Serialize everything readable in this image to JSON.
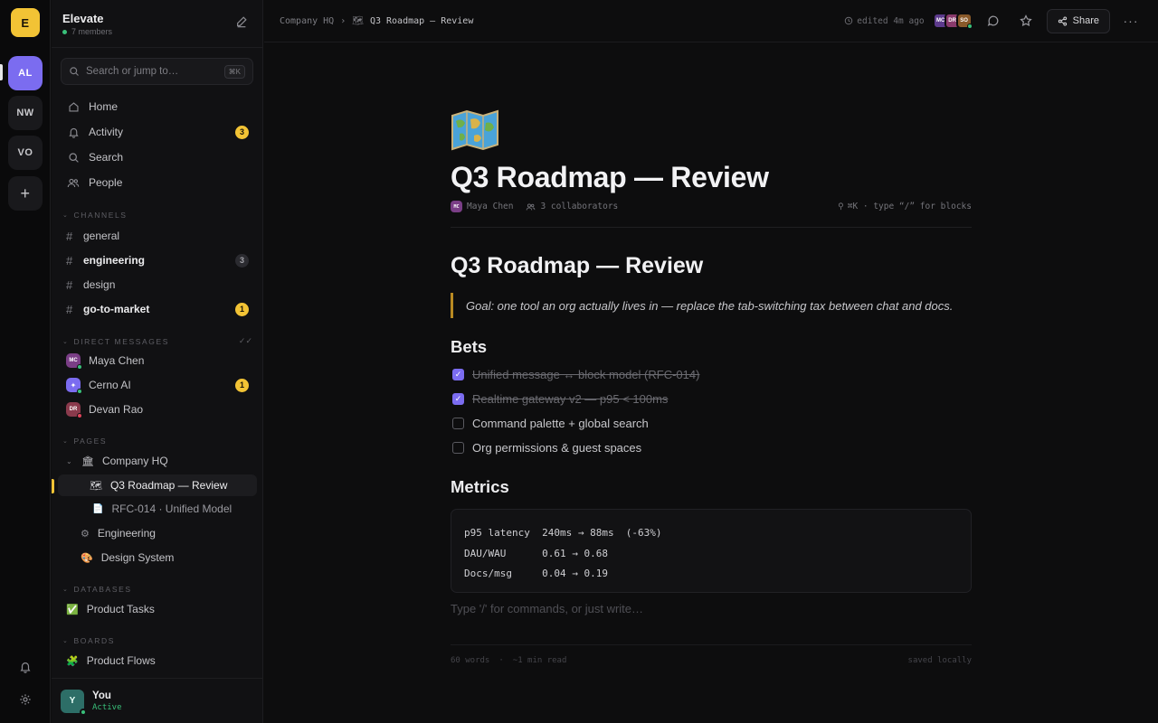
{
  "rail": {
    "logo": "E",
    "workspaces": [
      "AL",
      "NW",
      "VO"
    ],
    "add_icon": "plus-icon",
    "bottom_icons": [
      "bell-icon",
      "gear-icon"
    ]
  },
  "sidebar": {
    "workspace_name": "Elevate",
    "members": "7 members",
    "search_placeholder": "Search or jump to…",
    "search_shortcut": "⌘K",
    "nav": [
      {
        "label": "Home",
        "icon": "home-icon",
        "badge": ""
      },
      {
        "label": "Activity",
        "icon": "bell-icon",
        "badge": "3"
      },
      {
        "label": "Search",
        "icon": "search-icon",
        "badge": ""
      },
      {
        "label": "People",
        "icon": "people-icon",
        "badge": ""
      }
    ],
    "channels_label": "CHANNELS",
    "channels": [
      {
        "name": "general",
        "badge": ""
      },
      {
        "name": "engineering",
        "badge": "3"
      },
      {
        "name": "design",
        "badge": ""
      },
      {
        "name": "go-to-market",
        "badge": "1"
      }
    ],
    "dms_label": "DIRECT MESSAGES",
    "dms": [
      {
        "initials": "MC",
        "name": "Maya Chen",
        "badge": "",
        "color": "#7a3e86",
        "status": "#39c07a"
      },
      {
        "initials": "✦",
        "name": "Cerno AI",
        "badge": "1",
        "color": "#7b6cf0",
        "status": "#39c07a"
      },
      {
        "initials": "DR",
        "name": "Devan Rao",
        "badge": "",
        "color": "#8a3a4c",
        "status": "#e0445a"
      }
    ],
    "pages_label": "PAGES",
    "pages": [
      {
        "label": "Company HQ",
        "icon": "🏛"
      },
      {
        "label": "Q3 Roadmap — Review",
        "icon": "🗺"
      },
      {
        "label": "RFC-014 · Unified Model",
        "icon": "📄"
      },
      {
        "label": "Engineering",
        "icon": "⚙"
      },
      {
        "label": "Design System",
        "icon": "🎨"
      }
    ],
    "databases_label": "DATABASES",
    "databases": [
      {
        "label": "Product Tasks",
        "icon": "✅"
      }
    ],
    "boards_label": "BOARDS",
    "boards": [
      {
        "label": "Product Flows",
        "icon": "🧩"
      }
    ],
    "user": {
      "initial": "Y",
      "name": "You",
      "status": "Active"
    }
  },
  "topbar": {
    "breadcrumb_root": "Company HQ",
    "breadcrumb_page": "Q3 Roadmap — Review",
    "breadcrumb_icon": "🗺",
    "edited": "edited 4m ago",
    "collaborators": [
      {
        "initials": "MC",
        "color": "#5c3a8c"
      },
      {
        "initials": "DR",
        "color": "#8a3a6c"
      },
      {
        "initials": "SO",
        "color": "#8a5a2a"
      }
    ],
    "share_label": "Share"
  },
  "document": {
    "emoji": "map-emoji",
    "title": "Q3 Roadmap — Review",
    "author_initials": "MC",
    "author": "Maya Chen",
    "collaborators_count": "3 collaborators",
    "hint": "⌘K · type “/” for blocks",
    "heading": "Q3 Roadmap — Review",
    "quote": "Goal: one tool an org actually lives in — replace the tab-switching tax between chat and docs.",
    "bets_heading": "Bets",
    "bets": [
      {
        "label": "Unified message ↔ block model (RFC-014)",
        "done": true
      },
      {
        "label": "Realtime gateway v2 — p95 < 100ms",
        "done": true
      },
      {
        "label": "Command palette + global search",
        "done": false
      },
      {
        "label": "Org permissions & guest spaces",
        "done": false
      }
    ],
    "metrics_heading": "Metrics",
    "metrics_code": [
      "p95 latency  240ms → 88ms  (-63%)",
      "DAU/WAU      0.61 → 0.68",
      "Docs/msg     0.04 → 0.19"
    ],
    "placeholder": "Type '/' for commands, or just write…",
    "word_count": "60 words",
    "read_time": "~1 min read",
    "saved": "saved locally"
  }
}
